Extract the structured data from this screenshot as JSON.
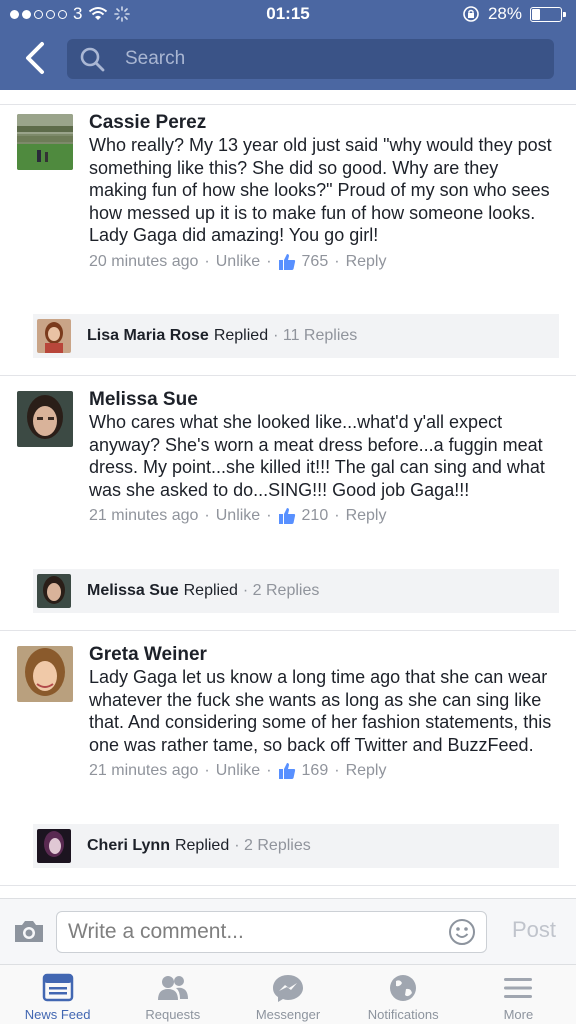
{
  "status_bar": {
    "carrier": "3",
    "time": "01:15",
    "battery": "28%",
    "battery_level": 0.28
  },
  "nav": {
    "search_placeholder": "Search"
  },
  "comments": [
    {
      "name": "Cassie Perez",
      "text": "Who really? My 13 year old just said \"why would they post something like this? She did so good. Why are they making fun of how she looks?\" Proud of my son who sees how messed up it is to make fun of how someone looks. Lady Gaga did amazing! You go girl!",
      "time": "20 minutes ago",
      "unlike": "Unlike",
      "likes": "765",
      "reply": "Reply",
      "replies": {
        "name": "Lisa Maria Rose",
        "word": "Replied",
        "count": "11 Replies"
      }
    },
    {
      "name": "Melissa Sue",
      "text": "Who cares what she looked like...what'd y'all expect anyway? She's worn a meat dress before...a fuggin meat dress. My point...she killed it!!! The gal can sing and what was she asked to do...SING!!! Good job Gaga!!!",
      "time": "21 minutes ago",
      "unlike": "Unlike",
      "likes": "210",
      "reply": "Reply",
      "replies": {
        "name": "Melissa Sue",
        "word": "Replied",
        "count": "2 Replies"
      }
    },
    {
      "name": "Greta Weiner",
      "text": "Lady Gaga let us know a long time ago that she can wear whatever the fuck she wants as long as she can sing like that.  And considering some of her fashion statements, this one was rather tame, so back off Twitter and BuzzFeed.",
      "time": "21 minutes ago",
      "unlike": "Unlike",
      "likes": "169",
      "reply": "Reply",
      "replies": {
        "name": "Cheri Lynn",
        "word": "Replied",
        "count": "2 Replies"
      }
    }
  ],
  "composer": {
    "placeholder": "Write a comment...",
    "post_label": "Post"
  },
  "tabs": [
    {
      "label": "News Feed",
      "icon": "news-feed-icon",
      "active": true
    },
    {
      "label": "Requests",
      "icon": "friend-requests-icon",
      "active": false
    },
    {
      "label": "Messenger",
      "icon": "messenger-icon",
      "active": false
    },
    {
      "label": "Notifications",
      "icon": "globe-icon",
      "active": false
    },
    {
      "label": "More",
      "icon": "menu-icon",
      "active": false
    }
  ],
  "colors": {
    "brand": "#4b67a2",
    "link_active": "#4267b2",
    "meta_gray": "#90949c"
  }
}
